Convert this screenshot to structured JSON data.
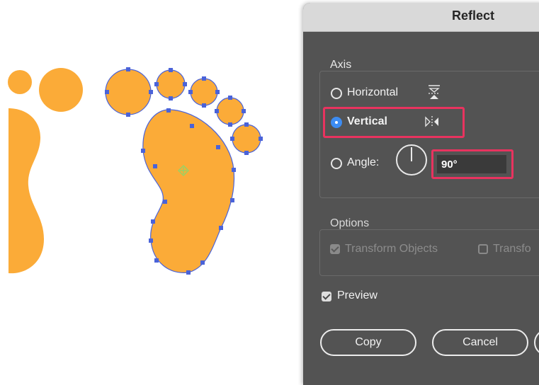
{
  "dialog": {
    "title": "Reflect",
    "axis": {
      "label": "Axis",
      "selected": "Vertical",
      "horizontal_label": "Horizontal",
      "vertical_label": "Vertical",
      "angle_label": "Angle:",
      "angle_value": "90°"
    },
    "options": {
      "label": "Options",
      "transform_objects_label": "Transform Objects",
      "transform_patterns_label": "Transfo"
    },
    "preview": {
      "label": "Preview",
      "checked": true
    },
    "buttons": {
      "copy": "Copy",
      "cancel": "Cancel"
    }
  },
  "artwork": {
    "fill_color": "#fbab38",
    "selection_color": "#4a63d9"
  },
  "colors": {
    "highlight": "#e8335f",
    "radio_selected": "#3d8cf2",
    "dialog_bg": "#535353",
    "titlebar_bg": "#d9d9d9"
  }
}
